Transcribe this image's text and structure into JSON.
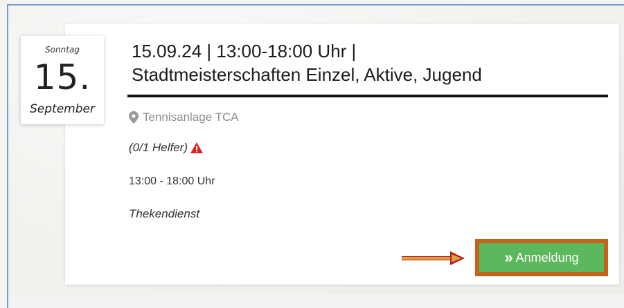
{
  "event": {
    "weekday": "Sonntag",
    "day": "15.",
    "month": "September",
    "title_line1": "15.09.24 | 13:00-18:00 Uhr |",
    "title_line2": "Stadtmeisterschaften Einzel, Aktive, Jugend",
    "location": "Tennisanlage TCA",
    "helpers": "(0/1 Helfer)",
    "time": "13:00 - 18:00 Uhr",
    "duty": "Thekendienst"
  },
  "actions": {
    "register_icon": "»",
    "register_label": "Anmeldung"
  },
  "colors": {
    "button_green": "#5cb85c",
    "highlight_orange": "#c7621c",
    "warning_red": "#e02020",
    "arrow_red": "#b31b1b"
  },
  "icons": {
    "location": "map-pin-icon",
    "warning": "warning-triangle-icon",
    "register": "double-chevron-right-icon",
    "annotation": "arrow-right-icon"
  }
}
